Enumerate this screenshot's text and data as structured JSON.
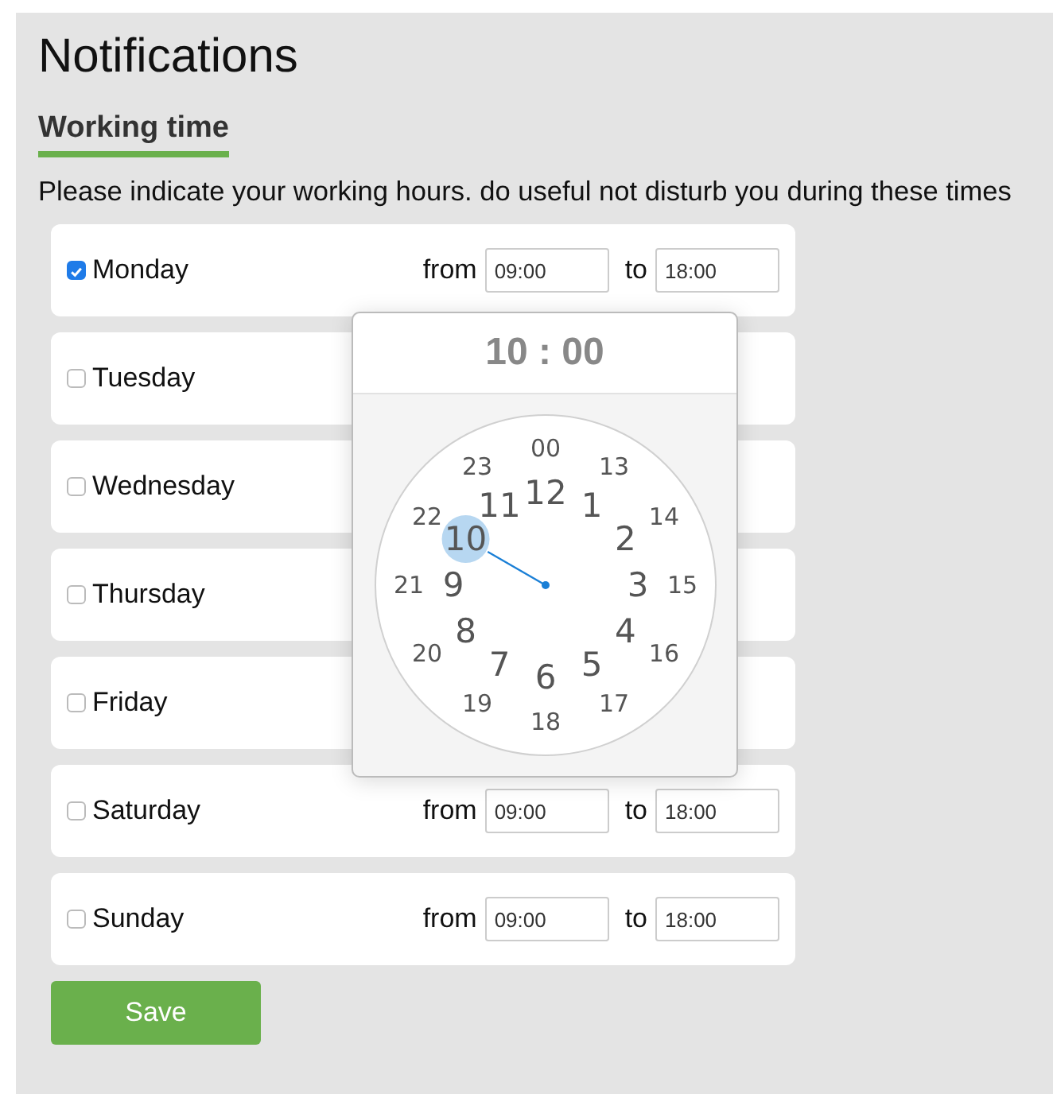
{
  "title": "Notifications",
  "section": {
    "title": "Working time"
  },
  "description": "Please indicate your working hours. do useful not disturb you during these times",
  "days": [
    {
      "name": "Monday",
      "checked": true,
      "from_label": "from",
      "from": "09:00",
      "to_label": "to",
      "to": "18:00"
    },
    {
      "name": "Tuesday",
      "checked": false
    },
    {
      "name": "Wednesday",
      "checked": false
    },
    {
      "name": "Thursday",
      "checked": false
    },
    {
      "name": "Friday",
      "checked": false
    },
    {
      "name": "Saturday",
      "checked": false,
      "from_label": "from",
      "from": "09:00",
      "to_label": "to",
      "to": "18:00"
    },
    {
      "name": "Sunday",
      "checked": false,
      "from_label": "from",
      "from": "09:00",
      "to_label": "to",
      "to": "18:00"
    }
  ],
  "time_picker": {
    "display": "10 : 00",
    "hours_inner": [
      {
        "label": "12",
        "selected": false
      },
      {
        "label": "11",
        "selected": false
      },
      {
        "label": "1",
        "selected": false
      },
      {
        "label": "10",
        "selected": true
      },
      {
        "label": "2",
        "selected": false
      },
      {
        "label": "9",
        "selected": false
      },
      {
        "label": "3",
        "selected": false
      },
      {
        "label": "8",
        "selected": false
      },
      {
        "label": "4",
        "selected": false
      },
      {
        "label": "7",
        "selected": false
      },
      {
        "label": "5",
        "selected": false
      },
      {
        "label": "6",
        "selected": false
      }
    ],
    "hours_outer": [
      {
        "label": "00",
        "selected": false
      },
      {
        "label": "23",
        "selected": false
      },
      {
        "label": "13",
        "selected": false
      },
      {
        "label": "22",
        "selected": false
      },
      {
        "label": "14",
        "selected": false
      },
      {
        "label": "21",
        "selected": false
      },
      {
        "label": "15",
        "selected": false
      },
      {
        "label": "20",
        "selected": false
      },
      {
        "label": "16",
        "selected": false
      },
      {
        "label": "19",
        "selected": false
      },
      {
        "label": "17",
        "selected": false
      },
      {
        "label": "18",
        "selected": false
      }
    ]
  },
  "save_button": "Save"
}
